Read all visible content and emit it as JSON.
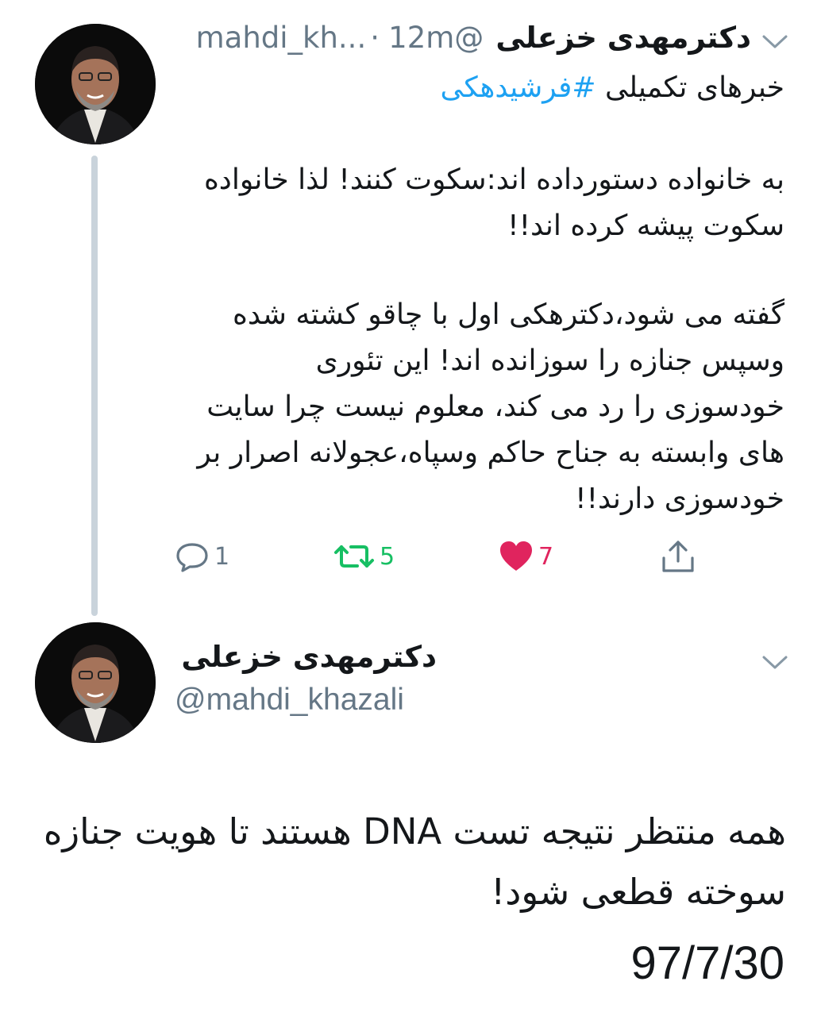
{
  "tweet1": {
    "display_name": "دکترمهدی خزعلی",
    "handle": "@mahdi_kh...",
    "dot": "·",
    "time": "12m",
    "line1_text": "خبرهای تکمیلی ",
    "hashtag": "#فرشیدهکی",
    "paragraph1": "به خانواده دستورداده اند:سکوت کنند!  لذا خانواده سکوت پیشه کرده اند!!",
    "paragraph2": "گفته می شود،دکترهکی اول با چاقو کشته شده وسپس جنازه را سوزانده اند! این تئوری خودسوزی را رد می کند، معلوم نیست چرا سایت های وابسته به جناح حاکم وسپاه،عجولانه اصرار بر خودسوزی دارند!!",
    "actions": {
      "reply_count": "1",
      "retweet_count": "5",
      "like_count": "7"
    },
    "icons": [
      "reply-icon",
      "retweet-icon",
      "heart-icon",
      "share-icon",
      "chevron-down-icon"
    ]
  },
  "tweet2": {
    "display_name": "دکترمهدی خزعلی",
    "handle": "@mahdi_khazali",
    "body": "همه منتظر نتیجه تست DNA هستند تا هویت جنازه سوخته قطعی شود!",
    "date": "97/7/30"
  },
  "colors": {
    "link": "#1da1f2",
    "handle_gray": "#657786",
    "retweet_green": "#17bf63",
    "like_red": "#e0245e",
    "thread_line": "#c9d3db"
  }
}
